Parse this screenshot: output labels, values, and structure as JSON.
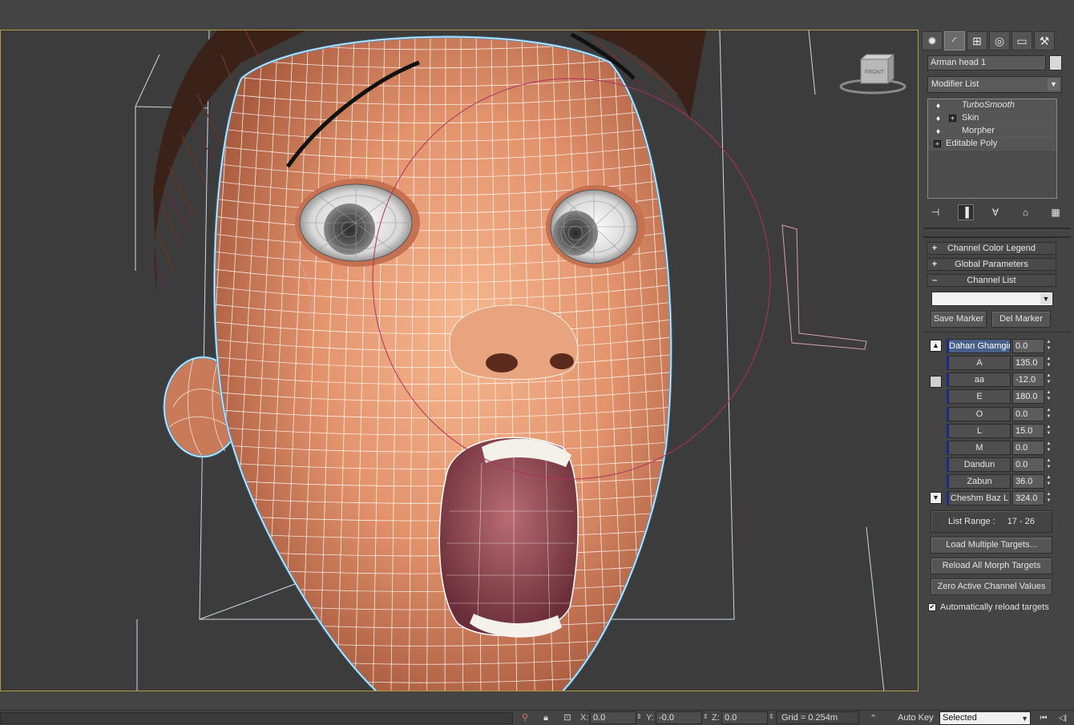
{
  "command_panel": {
    "tabs": [
      {
        "icon": "create-icon",
        "glyph": "✹"
      },
      {
        "icon": "modify-icon",
        "glyph": "◜"
      },
      {
        "icon": "hierarchy-icon",
        "glyph": "⊞"
      },
      {
        "icon": "motion-icon",
        "glyph": "◎"
      },
      {
        "icon": "display-icon",
        "glyph": "▭"
      },
      {
        "icon": "utilities-icon",
        "glyph": "⚒"
      }
    ],
    "object_name": "Arman head 1",
    "modifier_list_label": "Modifier List",
    "stack": [
      {
        "label": "TurboSmooth"
      },
      {
        "label": "Skin"
      },
      {
        "label": "Morpher"
      },
      {
        "label": "Editable Poly"
      }
    ]
  },
  "rollouts": {
    "color_legend": {
      "sign": "+",
      "title": "Channel Color Legend"
    },
    "global_params": {
      "sign": "+",
      "title": "Global Parameters"
    },
    "channel_list": {
      "sign": "–",
      "title": "Channel List"
    }
  },
  "markers": {
    "dropdown_value": "",
    "save_label": "Save Marker",
    "del_label": "Del Marker"
  },
  "channels": [
    {
      "name": "Dahan Ghamgin",
      "value": "0.0"
    },
    {
      "name": "A",
      "value": "135.0"
    },
    {
      "name": "aa",
      "value": "-12.0"
    },
    {
      "name": "E",
      "value": "180.0"
    },
    {
      "name": "O",
      "value": "0.0"
    },
    {
      "name": "L",
      "value": "15.0"
    },
    {
      "name": "M",
      "value": "0.0"
    },
    {
      "name": "Dandun",
      "value": "0.0"
    },
    {
      "name": "Zabun",
      "value": "36.0"
    },
    {
      "name": "Cheshm Baz L",
      "value": "324.0"
    }
  ],
  "list_range": {
    "label": "List Range :",
    "value": "17 - 26"
  },
  "buttons": {
    "load_multiple": "Load Multiple Targets...",
    "reload_all": "Reload All Morph Targets",
    "zero_active": "Zero Active Channel Values"
  },
  "auto_reload": {
    "label": "Automatically reload targets",
    "checked": true
  },
  "viewcube": {
    "face_label": "FRONT"
  },
  "statusbar": {
    "x_label": "X:",
    "x_value": "0.0",
    "y_label": "Y:",
    "y_value": "-0.0",
    "z_label": "Z:",
    "z_value": "0.0",
    "grid": "Grid = 0.254m",
    "auto_key": "Auto Key",
    "key_filter": "Selected"
  },
  "colors": {
    "viewport_border": "#b49a43",
    "skin": "#e29a74",
    "selection_outline": "#4ea3d8",
    "wire": "#ffffff",
    "gizmo": "#b03060",
    "selected_channel": "#46608a"
  }
}
